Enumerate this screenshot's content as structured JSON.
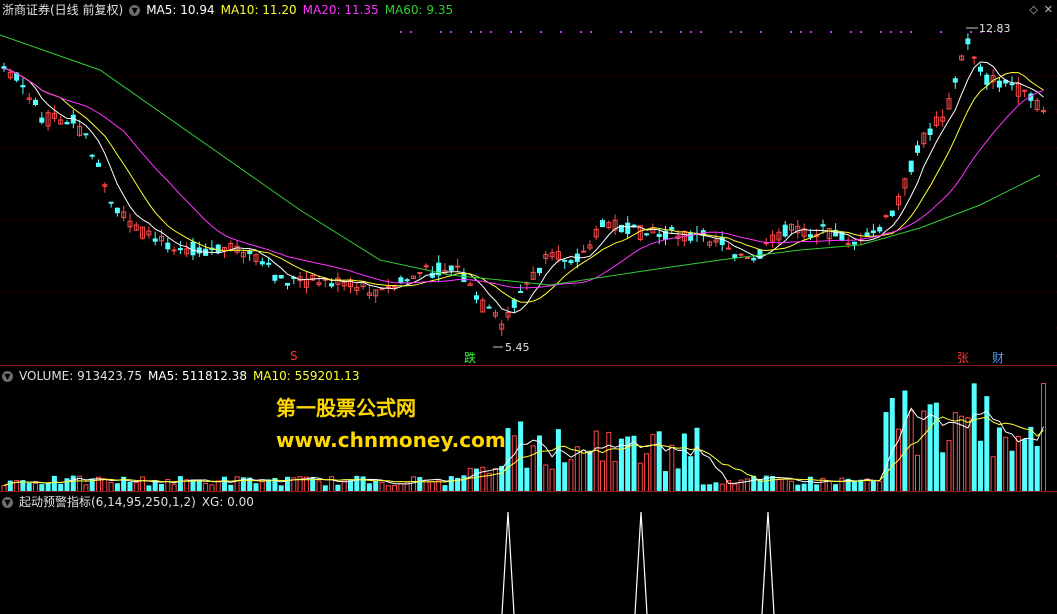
{
  "price": {
    "title": "浙商证券(日线 前复权)",
    "ma5": "MA5: 10.94",
    "ma10": "MA10: 11.20",
    "ma20": "MA20: 11.35",
    "ma60": "MA60: 9.35",
    "high_label": "12.83",
    "low_label": "5.45",
    "signals": {
      "s": "S",
      "die": "跌",
      "zhang": "张",
      "cai": "财"
    }
  },
  "volume": {
    "label": "VOLUME: 913423.75",
    "ma5": "MA5: 511812.38",
    "ma10": "MA10: 559201.13"
  },
  "indicator": {
    "label": "起动预警指标(6,14,95,250,1,2)",
    "xg": "XG: 0.00"
  },
  "watermark": {
    "line1": "第一股票公式网",
    "line2": "www.chnmoney.com"
  },
  "colors": {
    "up": "#ff4a4a",
    "down": "#54ffff",
    "ma5": "#ffffff",
    "ma10": "#ffff33",
    "ma20": "#ff33ff",
    "ma60": "#33cc33"
  }
}
